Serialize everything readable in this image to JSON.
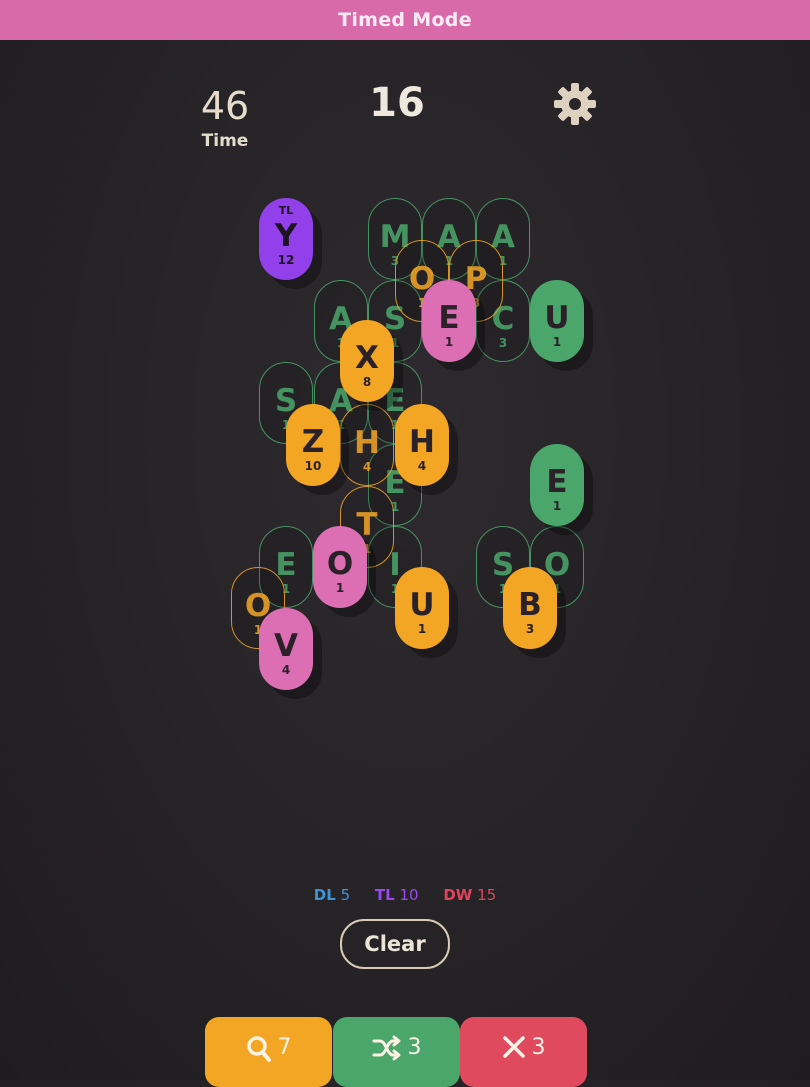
{
  "header": {
    "title": "Timed Mode"
  },
  "stats": {
    "time_value": "46",
    "time_label": "Time",
    "score": "16"
  },
  "colors": {
    "green": "#4aa66b",
    "orange": "#f2a623",
    "pink": "#dc6fb4",
    "purple": "#9140ea",
    "header_pink": "#d96aa9"
  },
  "tiles": [
    {
      "letter": "M",
      "points": "3",
      "style": "outline",
      "color": "green"
    },
    {
      "letter": "A",
      "points": "1",
      "style": "outline",
      "color": "green"
    },
    {
      "letter": "A",
      "points": "1",
      "style": "outline",
      "color": "green"
    },
    {
      "letter": "A",
      "points": "1",
      "style": "outline",
      "color": "green"
    },
    {
      "letter": "S",
      "points": "1",
      "style": "outline",
      "color": "green"
    },
    {
      "letter": "C",
      "points": "3",
      "style": "outline",
      "color": "green"
    },
    {
      "letter": "S",
      "points": "1",
      "style": "outline",
      "color": "green"
    },
    {
      "letter": "A",
      "points": "1",
      "style": "outline",
      "color": "green"
    },
    {
      "letter": "E",
      "points": "1",
      "style": "outline",
      "color": "green"
    },
    {
      "letter": "E",
      "points": "1",
      "style": "outline",
      "color": "green"
    },
    {
      "letter": "E",
      "points": "1",
      "style": "outline",
      "color": "green"
    },
    {
      "letter": "I",
      "points": "1",
      "style": "outline",
      "color": "green"
    },
    {
      "letter": "S",
      "points": "1",
      "style": "outline",
      "color": "green"
    },
    {
      "letter": "O",
      "points": "1",
      "style": "outline",
      "color": "green"
    },
    {
      "letter": "O",
      "points": "1",
      "style": "outline",
      "color": "orange"
    },
    {
      "letter": "P",
      "points": "3",
      "style": "outline",
      "color": "orange"
    },
    {
      "letter": "H",
      "points": "4",
      "style": "outline",
      "color": "orange"
    },
    {
      "letter": "T",
      "points": "1",
      "style": "outline",
      "color": "orange"
    },
    {
      "letter": "O",
      "points": "1",
      "style": "outline",
      "color": "orange"
    },
    {
      "letter": "Y",
      "points": "12",
      "modifier": "TL",
      "style": "solid",
      "color": "purple"
    },
    {
      "letter": "E",
      "points": "1",
      "style": "solid",
      "color": "pink"
    },
    {
      "letter": "U",
      "points": "1",
      "style": "solid",
      "color": "green"
    },
    {
      "letter": "X",
      "points": "8",
      "style": "solid",
      "color": "orange"
    },
    {
      "letter": "Z",
      "points": "10",
      "style": "solid",
      "color": "orange"
    },
    {
      "letter": "H",
      "points": "4",
      "style": "solid",
      "color": "orange"
    },
    {
      "letter": "E",
      "points": "1",
      "style": "solid",
      "color": "green"
    },
    {
      "letter": "O",
      "points": "1",
      "style": "solid",
      "color": "pink"
    },
    {
      "letter": "U",
      "points": "1",
      "style": "solid",
      "color": "orange"
    },
    {
      "letter": "B",
      "points": "3",
      "style": "solid",
      "color": "orange"
    },
    {
      "letter": "V",
      "points": "4",
      "style": "solid",
      "color": "pink"
    }
  ],
  "bonus": {
    "dl": {
      "label": "DL",
      "value": "5",
      "color": "#3f93d6"
    },
    "tl": {
      "label": "TL",
      "value": "10",
      "color": "#9a48f0"
    },
    "dw": {
      "label": "DW",
      "value": "15",
      "color": "#e0445a"
    }
  },
  "clear_label": "Clear",
  "powerups": [
    {
      "icon": "magnifier-icon",
      "count": "7",
      "color": "#f2a623"
    },
    {
      "icon": "shuffle-icon",
      "count": "3",
      "color": "#4aa66b"
    },
    {
      "icon": "close-icon",
      "count": "3",
      "color": "#e04a5e"
    }
  ]
}
